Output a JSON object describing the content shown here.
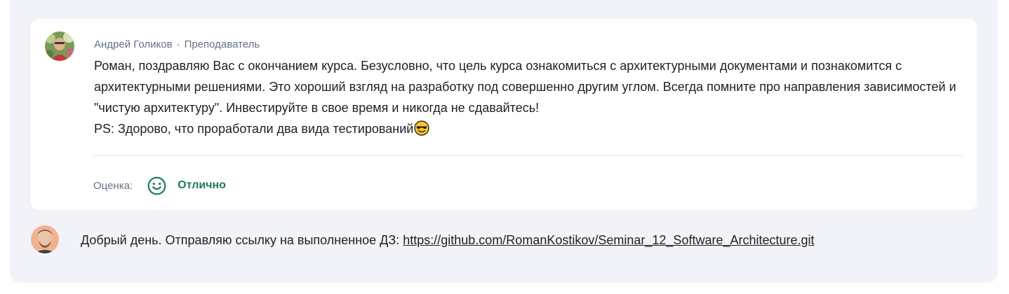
{
  "review": {
    "author_name": "Андрей Голиков",
    "separator": "·",
    "author_role": "Преподаватель",
    "lines": [
      "Роман, поздравляю Вас с окончанием курса. Безусловно, что цель курса ознакомиться с архитектурными документами и познакомится с архитектурными решениями. Это хороший взгляд на разработку под совершенно другим углом. Всегда помните про направления зависимостей и \"чистую архитектуру\". Инвестируйте в свое время и никогда не сдавайтесь!",
      "PS: Здорово, что проработали два вида тестирований"
    ],
    "emoji": "smiling-face-with-sunglasses-icon",
    "grade_label": "Оценка:",
    "grade_value": "Отлично",
    "grade_icon": "smile-icon",
    "grade_color": "#1b7a5a"
  },
  "student_message": {
    "text": "Добрый день. Отправляю ссылку на выполненное ДЗ: ",
    "link": "https://github.com/RomanKostikov/Seminar_12_Software_Architecture.git"
  },
  "colors": {
    "panel_bg": "#f2f3f8",
    "card_bg": "#ffffff",
    "muted_text": "#667085",
    "body_text": "#1f1f24"
  }
}
